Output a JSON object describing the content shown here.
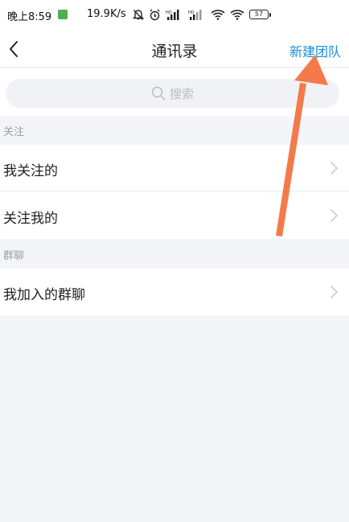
{
  "status_bar": {
    "time": "晚上8:59",
    "net_speed": "19.9K/s",
    "battery": "57"
  },
  "nav": {
    "back_icon": "chevron-left-icon",
    "title": "通讯录",
    "action": "新建团队",
    "action_color": "#1a8fe3"
  },
  "search": {
    "placeholder": "搜索",
    "icon": "search-icon"
  },
  "sections": [
    {
      "label": "关注",
      "items": [
        {
          "label": "我关注的"
        },
        {
          "label": "关注我的"
        }
      ]
    },
    {
      "label": "群聊",
      "items": [
        {
          "label": "我加入的群聊"
        }
      ]
    }
  ],
  "colors": {
    "background": "#f4f5f9",
    "card": "#ffffff",
    "annotation_arrow": "#f47a4b"
  }
}
